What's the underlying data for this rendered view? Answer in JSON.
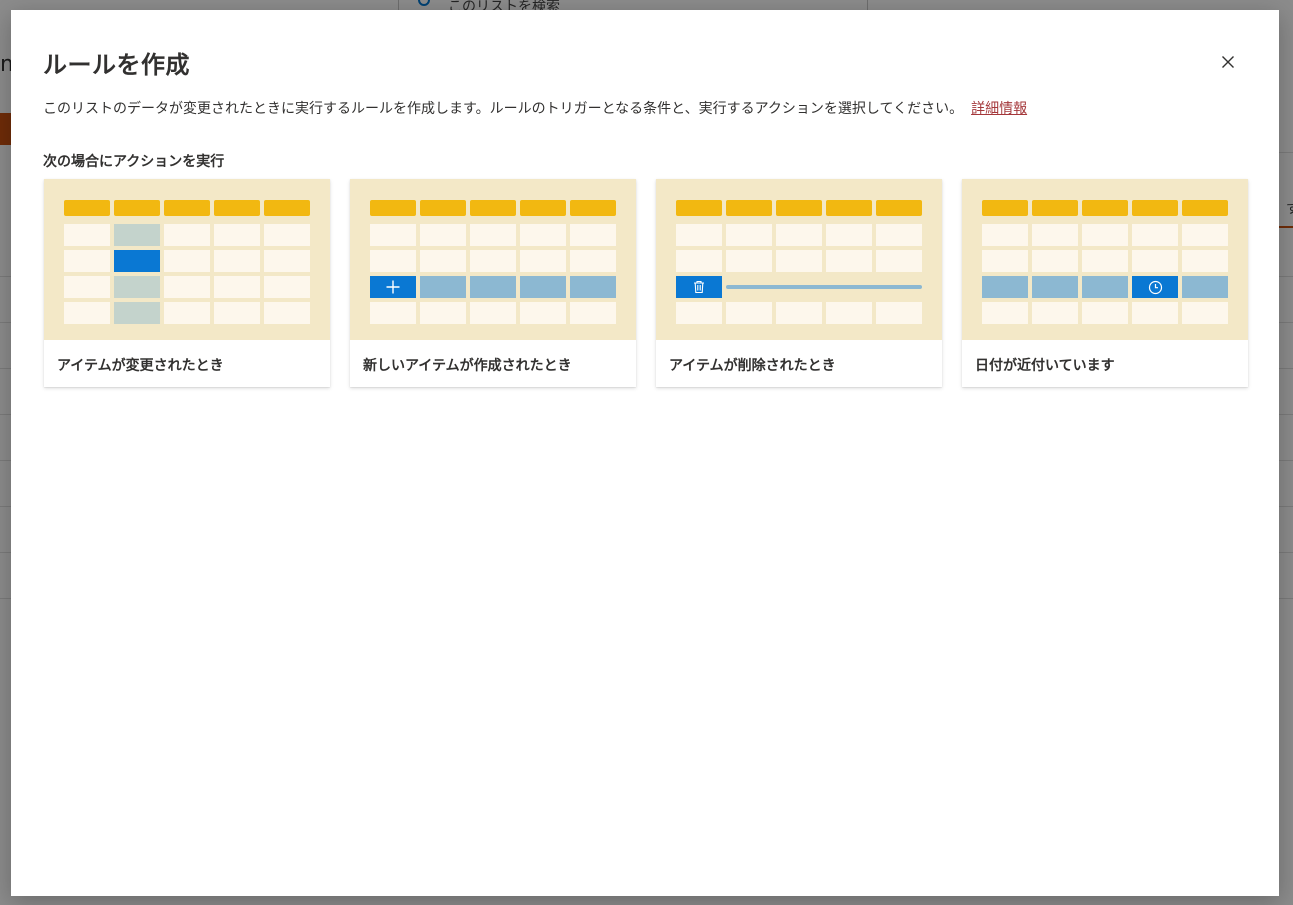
{
  "background": {
    "search_placeholder": "このリストを検索",
    "partial_letter": "m",
    "right_letter": "す"
  },
  "dialog": {
    "title": "ルールを作成",
    "description": "このリストのデータが変更されたときに実行するルールを作成します。ルールのトリガーとなる条件と、実行するアクションを選択してください。",
    "learn_more": "詳細情報",
    "section_label": "次の場合にアクションを実行",
    "close_icon": "close-icon"
  },
  "cards": [
    {
      "label": "アイテムが変更されたとき",
      "illustration": "item-changed"
    },
    {
      "label": "新しいアイテムが作成されたとき",
      "illustration": "item-created",
      "icon": "plus-icon"
    },
    {
      "label": "アイテムが削除されたとき",
      "illustration": "item-deleted",
      "icon": "trash-icon"
    },
    {
      "label": "日付が近付いています",
      "illustration": "date-approaching",
      "icon": "clock-icon"
    }
  ],
  "colors": {
    "header_cell": "#f2b811",
    "thumb_bg": "#f3e8c7",
    "cell": "#fdf7ec",
    "accent_blue": "#0a78d3",
    "row_highlight": "#8cb8d2",
    "column_highlight": "#c4d3cc",
    "link": "#a4373a"
  }
}
